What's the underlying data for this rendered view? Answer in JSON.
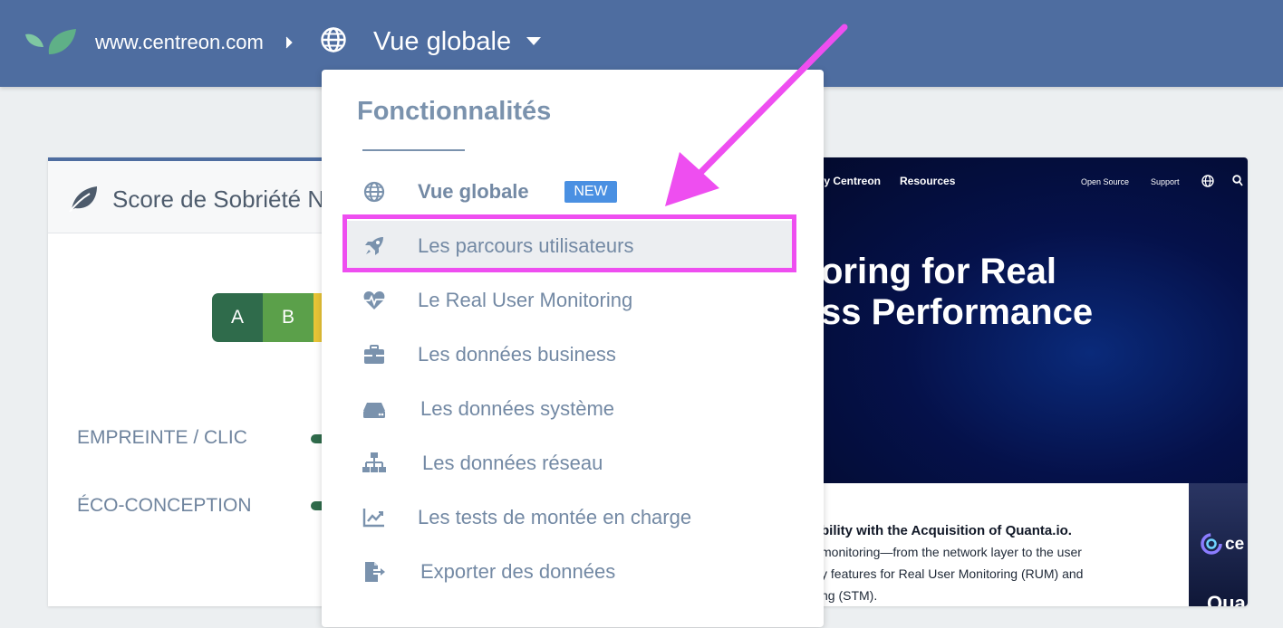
{
  "topbar": {
    "site": "www.centreon.com",
    "view": "Vue globale"
  },
  "score_card": {
    "title": "Score de Sobriété N",
    "grades": [
      "A",
      "B",
      ""
    ],
    "metrics": [
      "EMPREINTE / CLIC",
      "ÉCO-CONCEPTION"
    ]
  },
  "menu": {
    "title": "Fonctionnalités",
    "items": [
      {
        "label": "Vue globale",
        "icon": "globe-icon",
        "badge": "NEW"
      },
      {
        "label": "Les parcours utilisateurs",
        "icon": "rocket-icon"
      },
      {
        "label": "Le Real User Monitoring",
        "icon": "heartbeat-icon"
      },
      {
        "label": "Les données business",
        "icon": "briefcase-icon"
      },
      {
        "label": "Les données système",
        "icon": "server-icon"
      },
      {
        "label": "Les données réseau",
        "icon": "sitemap-icon"
      },
      {
        "label": "Les tests de montée en charge",
        "icon": "chart-line-icon"
      },
      {
        "label": "Exporter des données",
        "icon": "export-icon"
      }
    ]
  },
  "preview": {
    "nav": [
      "hy Centreon",
      "Resources",
      "Open Source",
      "Support"
    ],
    "hero": [
      "oring for Real",
      "ss Performance"
    ],
    "news_title": "bility with the Acquisition of Quanta.io.",
    "news_lines": [
      " monitoring—from the network layer to the user",
      "y features for Real User Monitoring (RUM) and",
      "ng (STM)."
    ],
    "promo": [
      "ce",
      "Qua"
    ]
  },
  "colors": {
    "topbar": "#4e6da0",
    "menu_text": "#7389a4",
    "highlight": "#ee4ef0",
    "badge": "#4a90e2"
  }
}
